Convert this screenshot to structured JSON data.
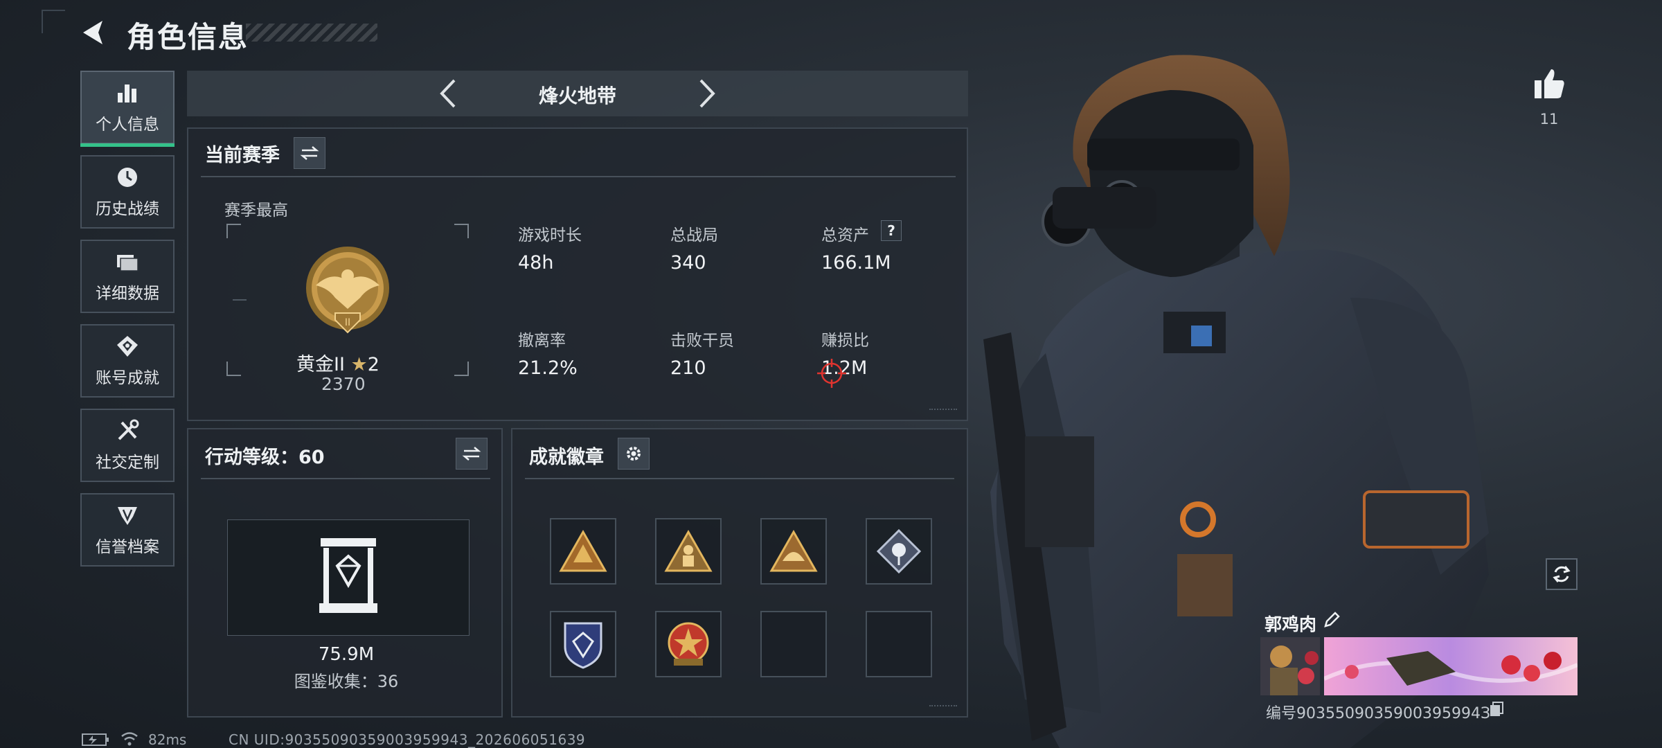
{
  "header": {
    "title": "角色信息"
  },
  "nav": [
    {
      "label": "个人信息",
      "icon": "bar-chart-icon",
      "active": true
    },
    {
      "label": "历史战绩",
      "icon": "clock-icon"
    },
    {
      "label": "详细数据",
      "icon": "folder-icon"
    },
    {
      "label": "账号成就",
      "icon": "achievement-icon"
    },
    {
      "label": "社交定制",
      "icon": "tools-icon"
    },
    {
      "label": "信誉档案",
      "icon": "credit-shield-icon"
    }
  ],
  "mode": {
    "label": "烽火地带"
  },
  "season": {
    "title": "当前赛季",
    "best_label": "赛季最高",
    "rank_name": "黄金II",
    "rank_stars": "2",
    "rank_points": "2370",
    "stats": [
      {
        "label": "游戏时长",
        "value": "48h"
      },
      {
        "label": "总战局",
        "value": "340"
      },
      {
        "label": "总资产",
        "value": "166.1M",
        "help": "?"
      },
      {
        "label": "撤离率",
        "value": "21.2%"
      },
      {
        "label": "击败干员",
        "value": "210"
      },
      {
        "label": "赚损比",
        "value": "1.2M"
      }
    ]
  },
  "level": {
    "title": "行动等级：60",
    "value": "75.9M",
    "collection": "图鉴收集：36"
  },
  "badges": {
    "title": "成就徽章",
    "items": [
      "triangle-badge",
      "triangle-soldier-badge",
      "triangle-helmet-badge",
      "diamond-rose-badge",
      "shield-emblem-badge",
      "star-emblem-badge",
      "empty",
      "empty"
    ]
  },
  "profile": {
    "like_count": "11",
    "name": "郭鸡肉",
    "id_text": "编号9035509035900395994З"
  },
  "status": {
    "ping": "82ms",
    "uid": "CN UID:90355090359003959943_202606051639"
  },
  "colors": {
    "accent": "#34c28a",
    "crosshair": "#e0342f"
  }
}
